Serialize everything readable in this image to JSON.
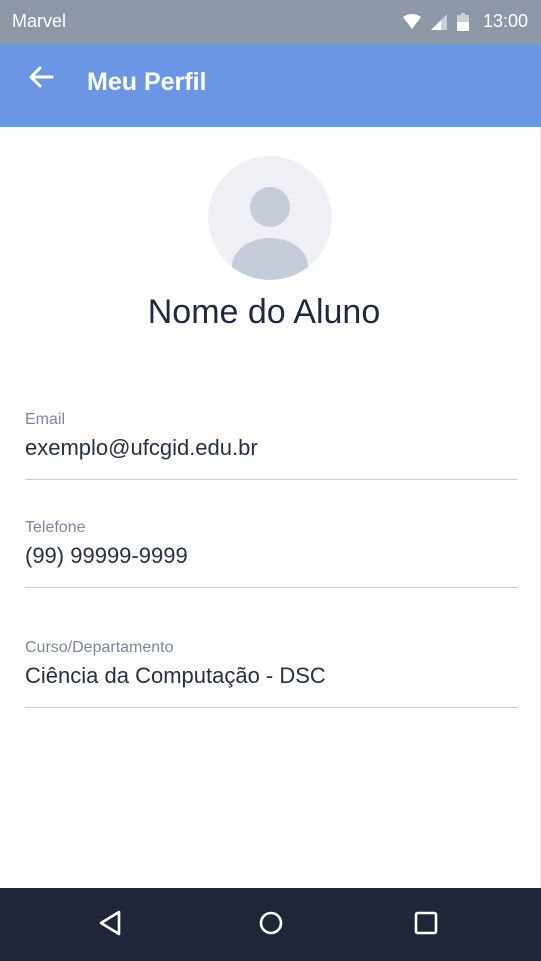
{
  "status_bar": {
    "carrier": "Marvel",
    "time": "13:00",
    "icons": [
      "wifi-icon",
      "signal-icon",
      "battery-icon"
    ]
  },
  "app_bar": {
    "title": "Meu Perfil",
    "back_icon": "arrow-left-icon",
    "color": "#6a96e4"
  },
  "profile": {
    "avatar_icon": "user-placeholder-icon",
    "name": "Nome do Aluno"
  },
  "fields": {
    "email": {
      "label": "Email",
      "value": "exemplo@ufcgid.edu.br"
    },
    "phone": {
      "label": "Telefone",
      "value": "(99) 99999-9999"
    },
    "course": {
      "label": "Curso/Departamento",
      "value": "Ciência da Computação - DSC"
    }
  },
  "nav_bar": {
    "icons": [
      "nav-back-icon",
      "nav-home-icon",
      "nav-recent-icon"
    ],
    "color": "#1e2638"
  }
}
